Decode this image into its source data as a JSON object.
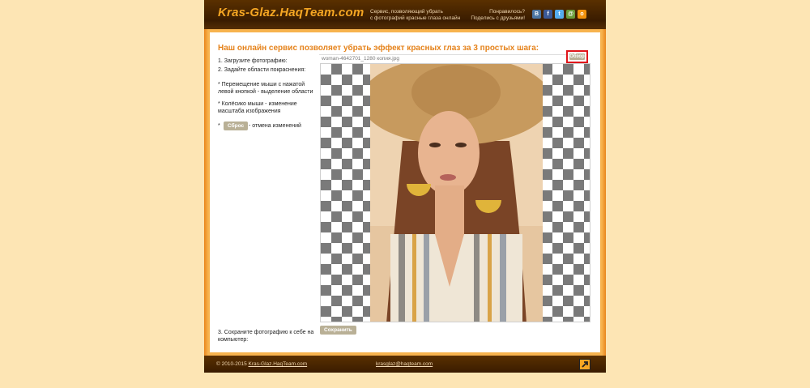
{
  "header": {
    "logo": "Kras-Glaz.HaqTeam.com",
    "tagline_line1": "Сервис, позволяющий убрать",
    "tagline_line2": "с фотографий красные глаза онлайн",
    "share_line1": "Понравилось?",
    "share_line2": "Поделись с друзьями!",
    "social": [
      {
        "name": "vk-icon",
        "glyph": "B",
        "color": "#4c75a3"
      },
      {
        "name": "facebook-icon",
        "glyph": "f",
        "color": "#3b5998"
      },
      {
        "name": "twitter-icon",
        "glyph": "t",
        "color": "#55acee"
      },
      {
        "name": "mailru-icon",
        "glyph": "@",
        "color": "#6a9c3a"
      },
      {
        "name": "odnoklassniki-icon",
        "glyph": "o",
        "color": "#f2920c"
      }
    ]
  },
  "main": {
    "headline": "Наш онлайн сервис позволяет убрать эффект красных глаз за 3 простых шага:",
    "step1": "1. Загрузите фотографию:",
    "step2": "2. Задайте области покраснения:",
    "tip1": "* Перемещение мыши с нажатой левой кнопкой - выделение области",
    "tip2": "* Колёсико мыши - изменение масштаба изображения",
    "tip3_prefix": "*",
    "reset_label": "Сброс",
    "reset_desc": "- отмена изменений",
    "file_name": "woman-4642701_1280 копия.jpg",
    "browse_label": "Обзор",
    "step3": "3. Сохраните фотографию к себе на компьютер:",
    "save_label": "Сохранить"
  },
  "footer": {
    "copyright_prefix": "© 2010-2015",
    "copyright_link": "Kras-Glaz.HaqTeam.com",
    "email": "krasglaz@haqteam.com",
    "top_icon": "arrow-up-right-icon"
  },
  "colors": {
    "background": "#fde5b4",
    "header_dark": "#3a1c00",
    "accent_orange": "#f5a623",
    "headline_orange": "#e5821a",
    "button_gray": "#b9b096",
    "highlight_red": "#e0161b"
  }
}
